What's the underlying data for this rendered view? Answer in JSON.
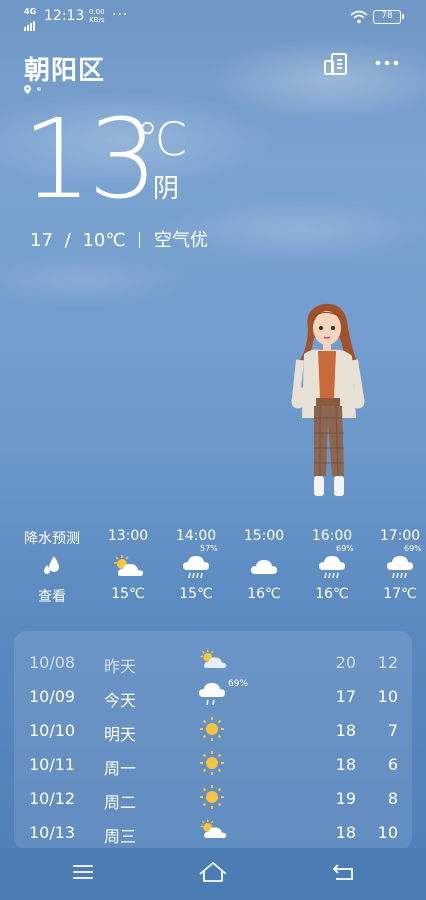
{
  "status_bar": {
    "network": "4G",
    "time": "12:13",
    "speed_value": "0.00",
    "speed_unit": "KB/s",
    "more": "···",
    "battery": "78"
  },
  "location": {
    "city": "朝阳区"
  },
  "current": {
    "temperature": "13",
    "unit": "℃",
    "condition": "阴",
    "high": "17",
    "range_sep": "/",
    "low": "10℃",
    "air_quality": "空气优"
  },
  "hourly": [
    {
      "time": "降水预测",
      "icon": "raindrops-icon",
      "value": "查看",
      "precip": ""
    },
    {
      "time": "13:00",
      "icon": "partly-cloudy-icon",
      "value": "15℃",
      "precip": ""
    },
    {
      "time": "14:00",
      "icon": "rain-cloud-icon",
      "value": "15℃",
      "precip": "57%"
    },
    {
      "time": "15:00",
      "icon": "cloud-icon",
      "value": "16℃",
      "precip": ""
    },
    {
      "time": "16:00",
      "icon": "rain-cloud-icon",
      "value": "16℃",
      "precip": "69%"
    },
    {
      "time": "17:00",
      "icon": "rain-cloud-icon",
      "value": "17℃",
      "precip": "69%"
    }
  ],
  "daily": [
    {
      "date": "10/08",
      "day": "昨天",
      "icon": "partly-cloudy-icon",
      "precip": "",
      "high": "20",
      "low": "12"
    },
    {
      "date": "10/09",
      "day": "今天",
      "icon": "rain-cloud-icon",
      "precip": "69%",
      "high": "17",
      "low": "10"
    },
    {
      "date": "10/10",
      "day": "明天",
      "icon": "sun-icon",
      "precip": "",
      "high": "18",
      "low": "7"
    },
    {
      "date": "10/11",
      "day": "周一",
      "icon": "sun-icon",
      "precip": "",
      "high": "18",
      "low": "6"
    },
    {
      "date": "10/12",
      "day": "周二",
      "icon": "sun-icon",
      "precip": "",
      "high": "19",
      "low": "8"
    },
    {
      "date": "10/13",
      "day": "周三",
      "icon": "partly-cloudy-icon",
      "precip": "",
      "high": "18",
      "low": "10"
    }
  ],
  "colors": {
    "sun": "#f6c343",
    "background_top": "#6f97c6",
    "background_bottom": "#4f7fb7"
  }
}
